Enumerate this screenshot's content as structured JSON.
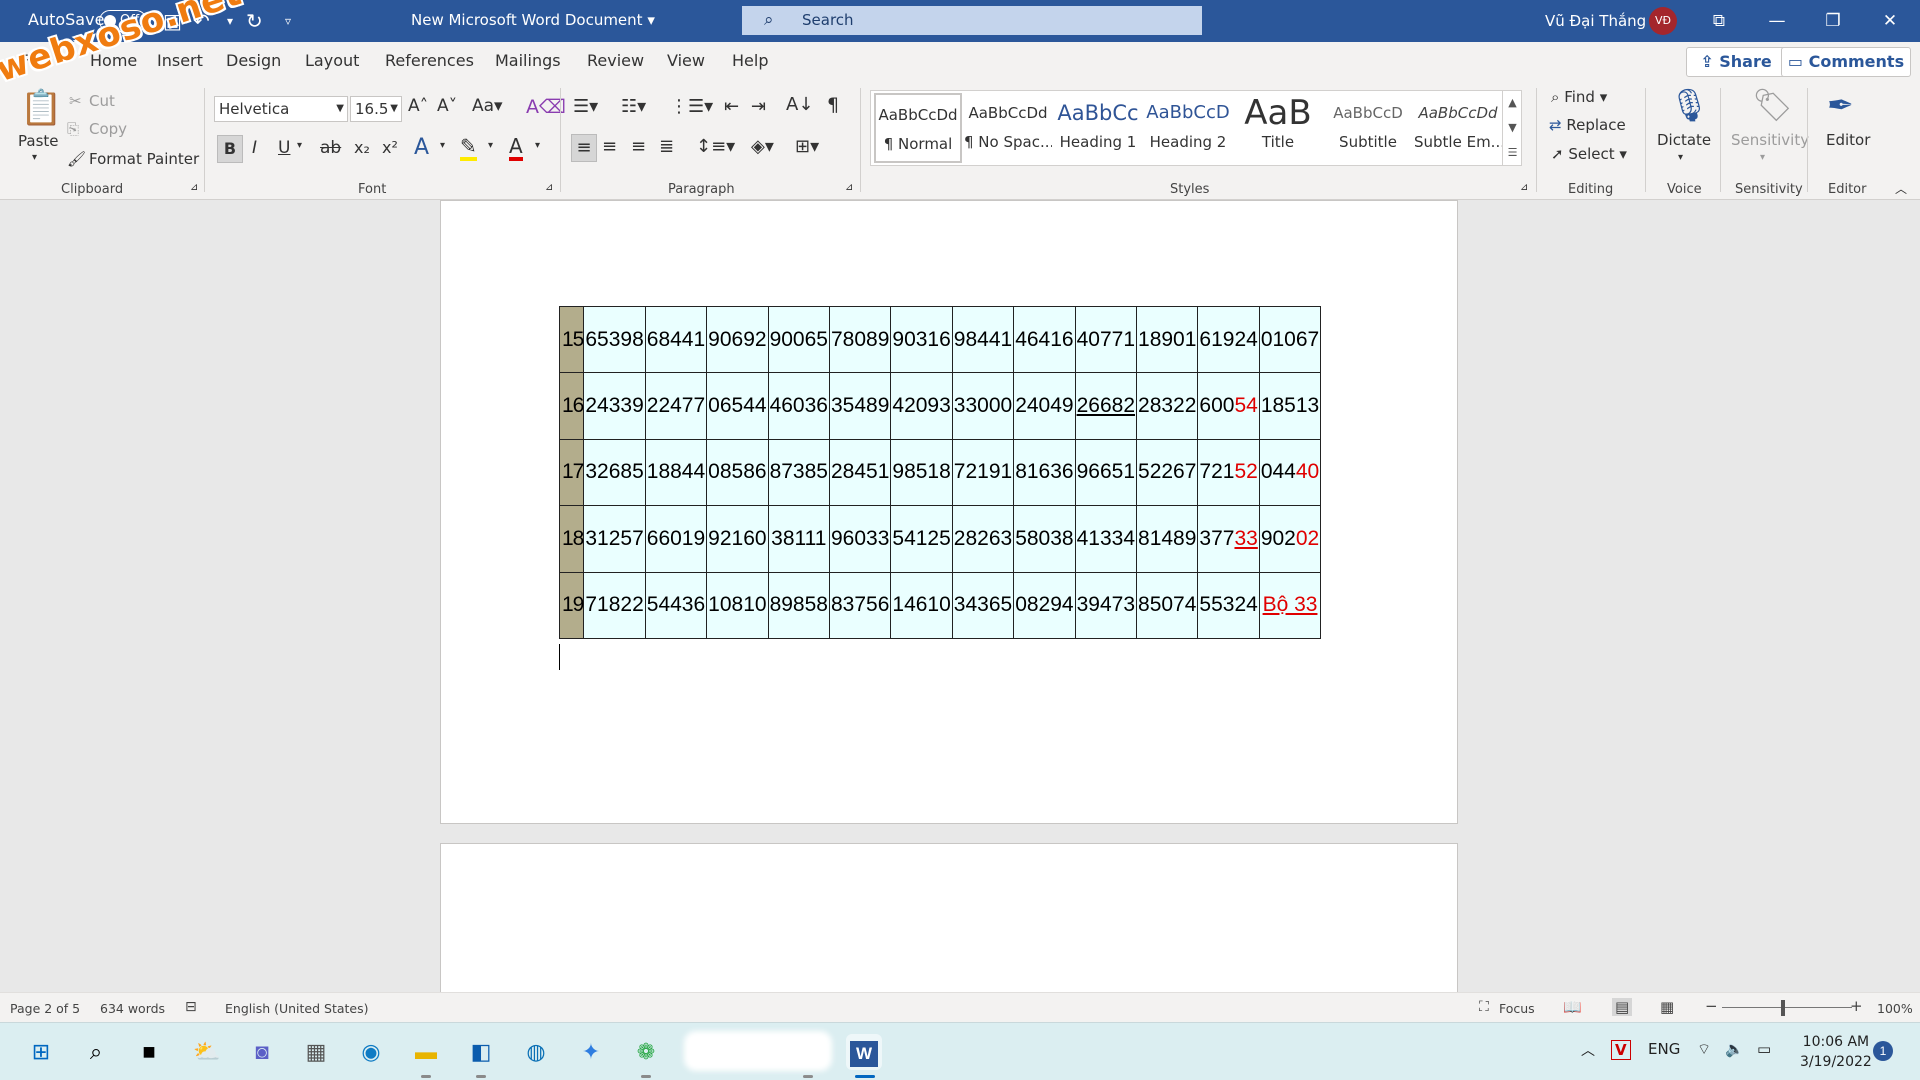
{
  "titlebar": {
    "autosave_label": "AutoSave",
    "autosave_state": "Off",
    "document_title": "New Microsoft Word Document",
    "search_placeholder": "Search",
    "user_name": "Vũ Đại Thắng",
    "user_initials": "VĐ"
  },
  "watermark": "webxoso.net",
  "menu": {
    "tabs": [
      "File",
      "Home",
      "Insert",
      "Design",
      "Layout",
      "References",
      "Mailings",
      "Review",
      "View",
      "Help"
    ],
    "share_label": "Share",
    "comments_label": "Comments"
  },
  "ribbon": {
    "clipboard": {
      "paste": "Paste",
      "cut": "Cut",
      "copy": "Copy",
      "format_painter": "Format Painter",
      "label": "Clipboard"
    },
    "font": {
      "name": "Helvetica",
      "size": "16.5",
      "label": "Font"
    },
    "paragraph": {
      "label": "Paragraph"
    },
    "styles": {
      "items": [
        {
          "preview": "AaBbCcDd",
          "name": "¶ Normal"
        },
        {
          "preview": "AaBbCcDd",
          "name": "¶ No Spac..."
        },
        {
          "preview": "AaBbCc",
          "name": "Heading 1"
        },
        {
          "preview": "AaBbCcD",
          "name": "Heading 2"
        },
        {
          "preview": "AaB",
          "name": "Title"
        },
        {
          "preview": "AaBbCcD",
          "name": "Subtitle"
        },
        {
          "preview": "AaBbCcDd",
          "name": "Subtle Em..."
        }
      ],
      "label": "Styles"
    },
    "editing": {
      "find": "Find",
      "replace": "Replace",
      "select": "Select",
      "label": "Editing"
    },
    "voice": {
      "dictate": "Dictate",
      "label": "Voice"
    },
    "sensitivity": {
      "button": "Sensitivity",
      "label": "Sensitivity"
    },
    "editor": {
      "button": "Editor",
      "label": "Editor"
    }
  },
  "table": {
    "rows": [
      {
        "label": "15",
        "cells": [
          "65398",
          "68441",
          "90692",
          "90065",
          "78089",
          "90316",
          "98441",
          "46416",
          "40771",
          "18901",
          "61924",
          "01067"
        ]
      },
      {
        "label": "16",
        "cells": [
          "24339",
          "22477",
          "06544",
          "46036",
          "35489",
          "42093",
          "33000",
          "24049",
          "26682",
          "28322",
          "60054",
          "18513"
        ]
      },
      {
        "label": "17",
        "cells": [
          "32685",
          "18844",
          "08586",
          "87385",
          "28451",
          "98518",
          "72191",
          "81636",
          "96651",
          "52267",
          "72152",
          "04440"
        ]
      },
      {
        "label": "18",
        "cells": [
          "31257",
          "66019",
          "92160",
          "38111",
          "96033",
          "54125",
          "28263",
          "58038",
          "41334",
          "81489",
          "37733",
          "90202"
        ]
      },
      {
        "label": "19",
        "cells": [
          "71822",
          "54436",
          "10810",
          "89858",
          "83756",
          "14610",
          "34365",
          "08294",
          "39473",
          "85074",
          "55324",
          " Bộ 33"
        ]
      }
    ],
    "highlights": {
      "1-10": {
        "plain": "600",
        "red": "54"
      },
      "2-10": {
        "plain": "721",
        "red": "52"
      },
      "2-11": {
        "plain": "044",
        "red": "40"
      },
      "3-10": {
        "plain": "377",
        "red": "33",
        "underline_red": true
      },
      "3-11": {
        "plain": "902",
        "red": "02"
      },
      "4-11": {
        "plain": "",
        "red": " Bộ 33",
        "underline_red": true
      }
    },
    "underlined": [
      "1-8"
    ]
  },
  "statusbar": {
    "page": "Page 2 of 5",
    "words": "634 words",
    "language": "English (United States)",
    "focus": "Focus",
    "zoom": "100%"
  },
  "tray": {
    "language": "ENG",
    "time": "10:06 AM",
    "date": "3/19/2022",
    "notifications": "1"
  },
  "colors": {
    "word_blue": "#2b579a",
    "table_fill": "#eaffff",
    "row_header_fill": "#b3ad8c",
    "highlight_red": "#e00000"
  }
}
